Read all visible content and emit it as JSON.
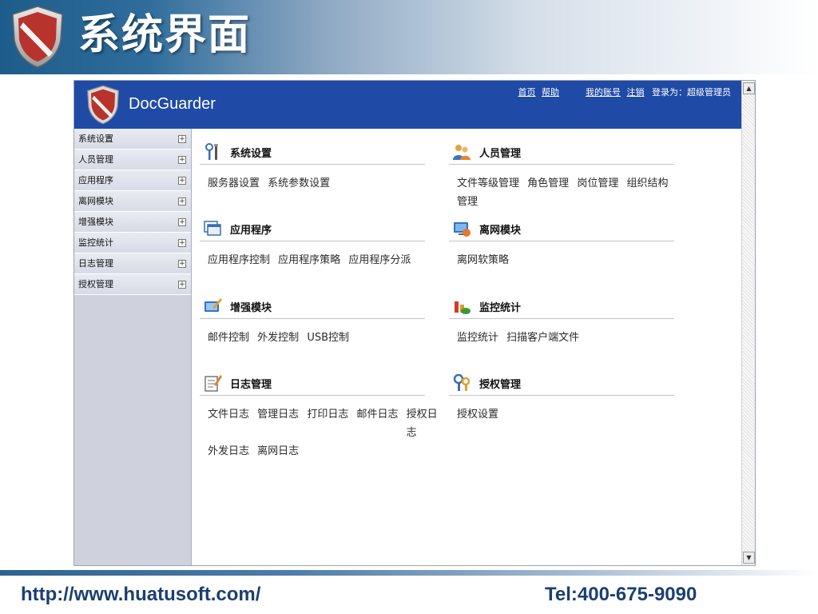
{
  "slide": {
    "title": "系统界面",
    "url": "http://www.huatusoft.com/",
    "tel": "Tel:400-675-9090"
  },
  "app": {
    "name": "DocGuarder",
    "top_links": {
      "home": "首页",
      "help": "帮助",
      "my_account": "我的账号",
      "logout": "注销",
      "login_status": "登录为：超级管理员"
    }
  },
  "sidebar": {
    "items": [
      {
        "label": "系统设置"
      },
      {
        "label": "人员管理"
      },
      {
        "label": "应用程序"
      },
      {
        "label": "离网模块"
      },
      {
        "label": "增强模块"
      },
      {
        "label": "监控统计"
      },
      {
        "label": "日志管理"
      },
      {
        "label": "授权管理"
      }
    ]
  },
  "sections": {
    "system": {
      "title": "系统设置",
      "links": [
        "服务器设置",
        "系统参数设置"
      ],
      "icon": "settings-tools-icon"
    },
    "people": {
      "title": "人员管理",
      "links": [
        "文件等级管理",
        "角色管理",
        "岗位管理",
        "组织结构管理"
      ],
      "icon": "users-icon"
    },
    "apps": {
      "title": "应用程序",
      "links": [
        "应用程序控制",
        "应用程序策略",
        "应用程序分派"
      ],
      "icon": "window-icon"
    },
    "offline": {
      "title": "离网模块",
      "links": [
        "离网软策略"
      ],
      "icon": "offline-network-icon"
    },
    "enhance": {
      "title": "增强模块",
      "links": [
        "邮件控制",
        "外发控制",
        "USB控制"
      ],
      "icon": "enhance-module-icon"
    },
    "monitor": {
      "title": "监控统计",
      "links": [
        "监控统计",
        "扫描客户端文件"
      ],
      "icon": "monitor-stats-icon"
    },
    "logs": {
      "title": "日志管理",
      "links": [
        "文件日志",
        "管理日志",
        "打印日志",
        "邮件日志",
        "授权日志",
        "外发日志",
        "离网日志"
      ],
      "icon": "log-notepad-icon"
    },
    "license": {
      "title": "授权管理",
      "links": [
        "授权设置"
      ],
      "icon": "license-keys-icon"
    }
  }
}
